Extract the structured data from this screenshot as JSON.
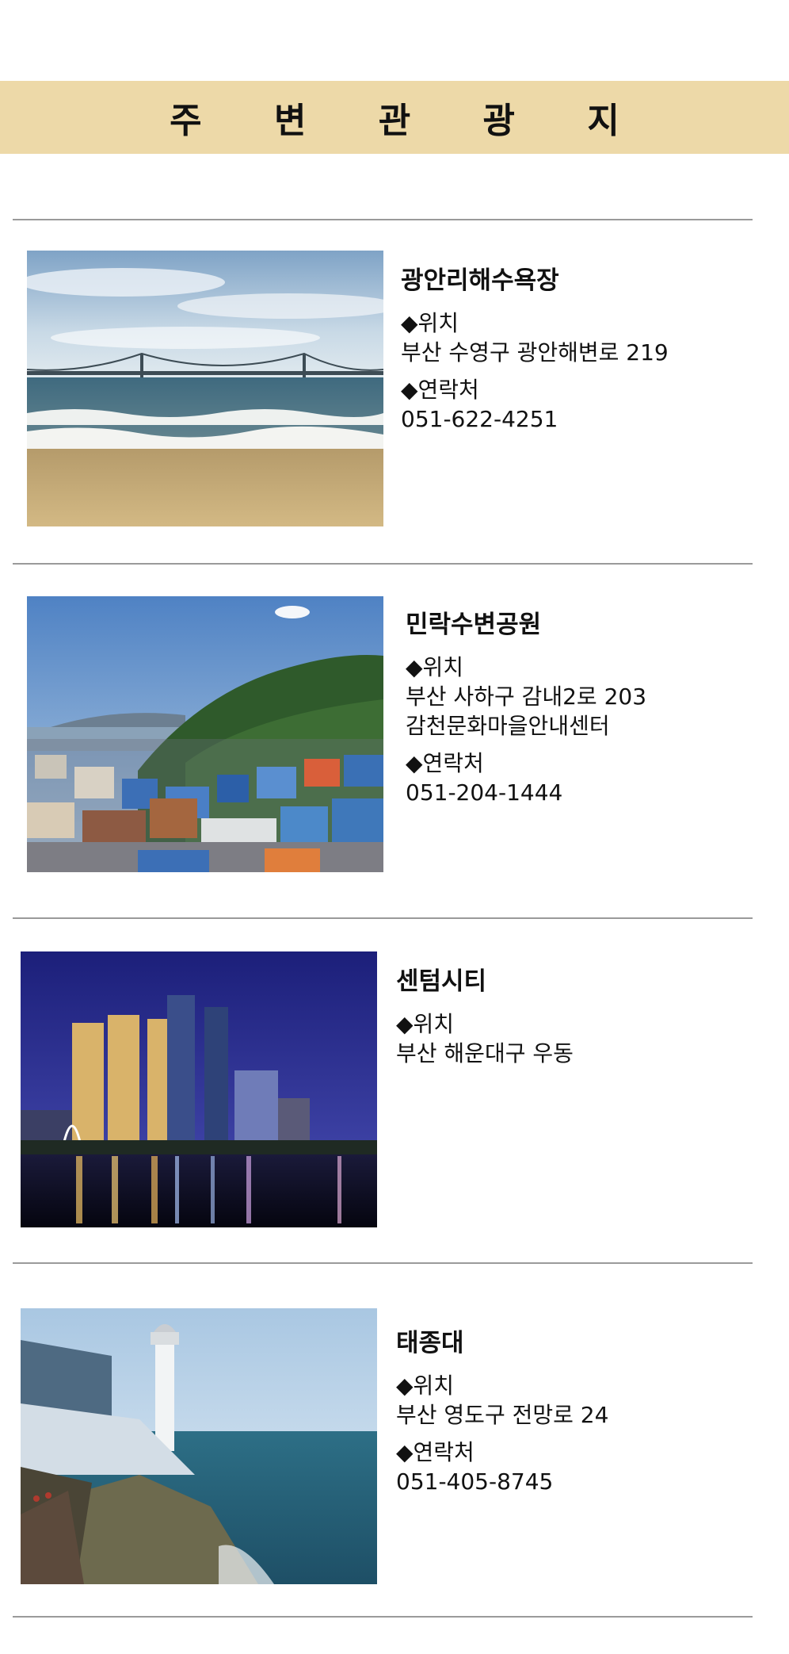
{
  "header": {
    "title": "주 변 관 광 지"
  },
  "spots": [
    {
      "name": "광안리해수욕장",
      "location_label": "◆위치",
      "location_lines": [
        "부산 수영구 광안해변로 219"
      ],
      "contact_label": "◆연락처",
      "contact": "051-622-4251",
      "photo_icon": "beach-bridge-photo"
    },
    {
      "name": "민락수변공원",
      "location_label": "◆위치",
      "location_lines": [
        "부산 사하구 감내2로 203",
        "감천문화마을안내센터"
      ],
      "contact_label": "◆연락처",
      "contact": "051-204-1444",
      "photo_icon": "hillside-village-photo"
    },
    {
      "name": "센텀시티",
      "location_label": "◆위치",
      "location_lines": [
        "부산 해운대구 우동"
      ],
      "photo_icon": "night-skyline-photo"
    },
    {
      "name": "태종대",
      "location_label": "◆위치",
      "location_lines": [
        "부산 영도구 전망로 24"
      ],
      "contact_label": "◆연락처",
      "contact": "051-405-8745",
      "photo_icon": "lighthouse-cliff-photo"
    }
  ],
  "colors": {
    "banner": "#edd9a8",
    "divider": "#9a9a9a"
  }
}
